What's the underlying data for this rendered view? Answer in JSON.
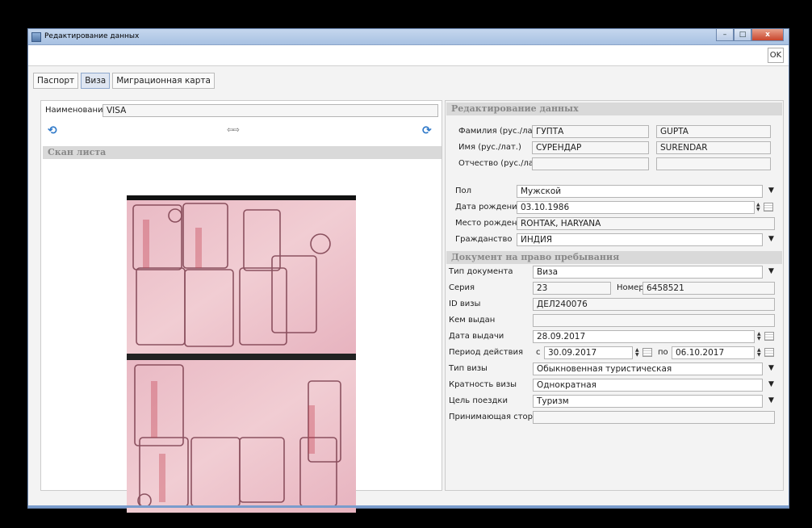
{
  "window": {
    "title": "Редактирование данных",
    "ok_label": "OK",
    "minimize_label": "–",
    "maximize_label": "□",
    "close_label": "x"
  },
  "tabs": [
    {
      "label": "Паспорт",
      "active": false
    },
    {
      "label": "Виза",
      "active": true
    },
    {
      "label": "Миграционная карта",
      "active": false
    }
  ],
  "left": {
    "name_label": "Наименование",
    "name_value": "VISA",
    "nav_arrows": "⇦⇨",
    "scan_header": "Скан листа"
  },
  "right": {
    "header": "Редактирование данных",
    "surname_label": "Фамилия (рус./лат.)",
    "surname_ru": "ГУПТА",
    "surname_lat": "GUPTA",
    "name_label": "Имя (рус./лат.)",
    "name_ru": "СУРЕНДАР",
    "name_lat": "SURENDAR",
    "patronymic_label": "Отчество (рус./лат.)",
    "patronymic_ru": "",
    "patronymic_lat": "",
    "sex_label": "Пол",
    "sex_value": "Мужской",
    "birthdate_label": "Дата рождения",
    "birthdate_value": "03.10.1986",
    "birthplace_label": "Место рождения",
    "birthplace_value": "ROHTAK, HARYANA",
    "citizenship_label": "Гражданство",
    "citizenship_value": "ИНДИЯ",
    "doc_section": "Документ на право пребывания",
    "doc_type_label": "Тип документа",
    "doc_type_value": "Виза",
    "series_label": "Серия",
    "series_value": "23",
    "number_label": "Номер",
    "number_value": "6458521",
    "visa_id_label": "ID визы",
    "visa_id_value": "ДЕЛ240076",
    "issued_by_label": "Кем выдан",
    "issued_by_value": "",
    "issue_date_label": "Дата выдачи",
    "issue_date_value": "28.09.2017",
    "validity_label": "Период действия",
    "from_label": "с",
    "from_value": "30.09.2017",
    "to_label": "по",
    "to_value": "06.10.2017",
    "visa_type_label": "Тип визы",
    "visa_type_value": "Обыкновенная туристическая",
    "multiplicity_label": "Кратность визы",
    "multiplicity_value": "Однократная",
    "purpose_label": "Цель поездки",
    "purpose_value": "Туризм",
    "host_label": "Принимающая сторона",
    "host_value": ""
  }
}
